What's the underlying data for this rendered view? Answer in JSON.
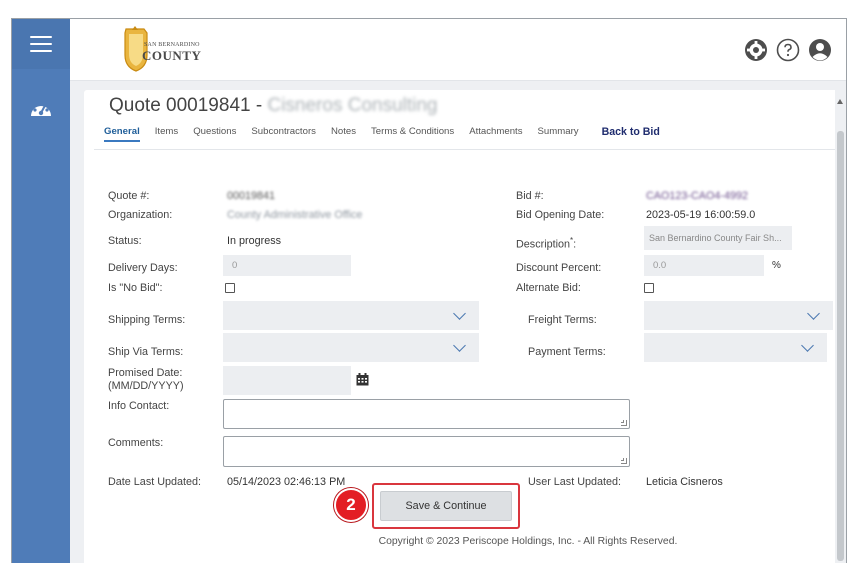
{
  "app": {
    "logo_small": "SAN BERNARDINO",
    "logo_big": "COUNTY"
  },
  "header": {
    "icons": [
      "gear-icon",
      "help-icon",
      "user-icon"
    ]
  },
  "page": {
    "title_prefix": "Quote 00019841 - ",
    "title_vendor": "Cisneros Consulting"
  },
  "tabs": [
    {
      "label": "General",
      "active": true
    },
    {
      "label": "Items"
    },
    {
      "label": "Questions"
    },
    {
      "label": "Subcontractors"
    },
    {
      "label": "Notes"
    },
    {
      "label": "Terms & Conditions"
    },
    {
      "label": "Attachments"
    },
    {
      "label": "Summary"
    }
  ],
  "back_to_bid": "Back to Bid",
  "form": {
    "quote_no_label": "Quote #:",
    "quote_no_value": "00019841",
    "organization_label": "Organization:",
    "organization_value": "County Administrative Office",
    "status_label": "Status:",
    "status_value": "In progress",
    "delivery_days_label": "Delivery Days:",
    "delivery_days_value": "0",
    "no_bid_label": "Is \"No Bid\":",
    "shipping_terms_label": "Shipping Terms:",
    "ship_via_label": "Ship Via Terms:",
    "promised_date_label_1": "Promised Date:",
    "promised_date_label_2": "(MM/DD/YYYY)",
    "info_contact_label": "Info Contact:",
    "comments_label": "Comments:",
    "date_updated_label": "Date Last Updated:",
    "date_updated_value": "05/14/2023 02:46:13 PM",
    "bid_no_label": "Bid #:",
    "bid_no_value": "CAO123-CAO4-4992",
    "bid_opening_label": "Bid Opening Date:",
    "bid_opening_value": "2023-05-19 16:00:59.0",
    "description_label": "Description",
    "description_required": "*",
    "description_colon": ":",
    "description_value": "San Bernardino County Fair Sh...",
    "discount_label": "Discount Percent:",
    "discount_value": "0.0",
    "discount_unit": "%",
    "alternate_label": "Alternate Bid:",
    "freight_label": "Freight Terms:",
    "payment_label": "Payment Terms:",
    "user_updated_label": "User Last Updated:",
    "user_updated_value": "Leticia Cisneros"
  },
  "actions": {
    "save_label": "Save & Continue",
    "step_number": "2"
  },
  "footer": {
    "copyright": "Copyright © 2023 Periscope Holdings, Inc. - All Rights Reserved."
  }
}
